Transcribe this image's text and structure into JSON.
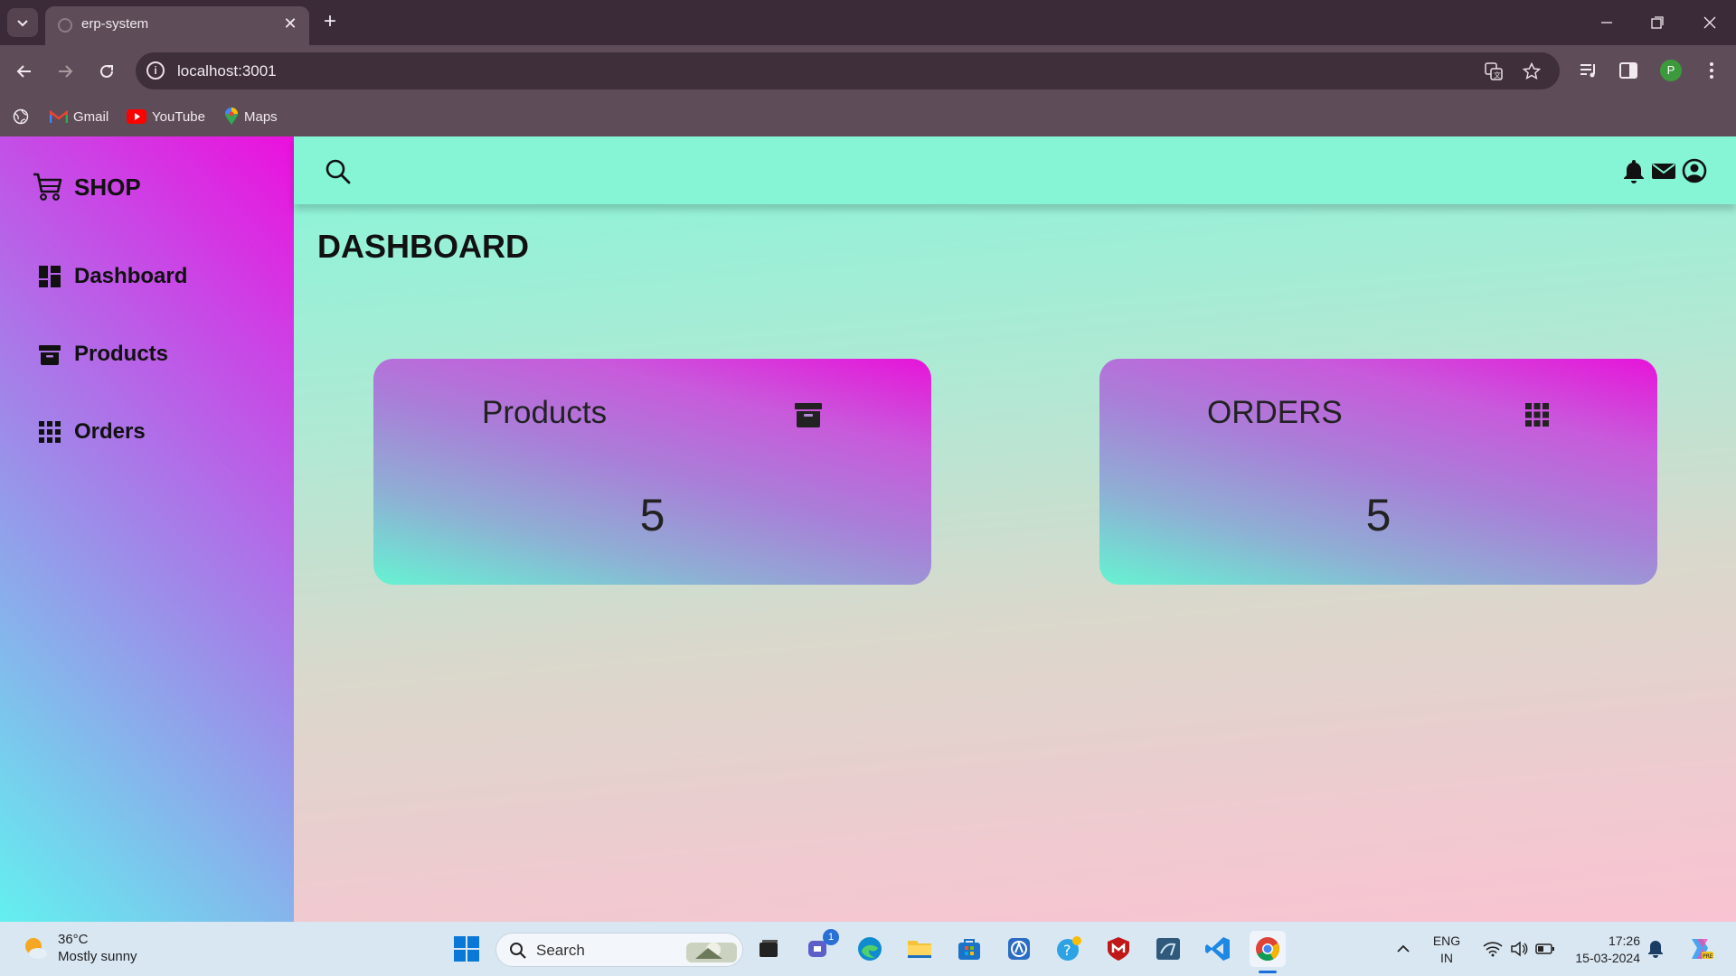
{
  "browser": {
    "tab_title": "erp-system",
    "url": "localhost:3001",
    "profile_initial": "P",
    "bookmarks": [
      {
        "label": "Gmail"
      },
      {
        "label": "YouTube"
      },
      {
        "label": "Maps"
      }
    ]
  },
  "sidebar": {
    "brand": "SHOP",
    "items": [
      {
        "label": "Dashboard",
        "icon": "dashboard-icon"
      },
      {
        "label": "Products",
        "icon": "archive-icon"
      },
      {
        "label": "Orders",
        "icon": "grid-icon"
      }
    ]
  },
  "main": {
    "title": "DASHBOARD",
    "cards": [
      {
        "title": "Products",
        "value": "5",
        "icon": "archive-icon"
      },
      {
        "title": "ORDERS",
        "value": "5",
        "icon": "grid-icon"
      }
    ]
  },
  "taskbar": {
    "weather_temp": "36°C",
    "weather_desc": "Mostly sunny",
    "search_placeholder": "Search",
    "lang_line1": "ENG",
    "lang_line2": "IN",
    "time": "17:26",
    "date": "15-03-2024",
    "teams_badge": "1"
  },
  "colors": {
    "sidebar_gradient": [
      "#63f0ef",
      "#ec10dd"
    ],
    "topbar": "#85f5d6",
    "card_gradient": [
      "#66f3d2",
      "#e714da"
    ]
  }
}
